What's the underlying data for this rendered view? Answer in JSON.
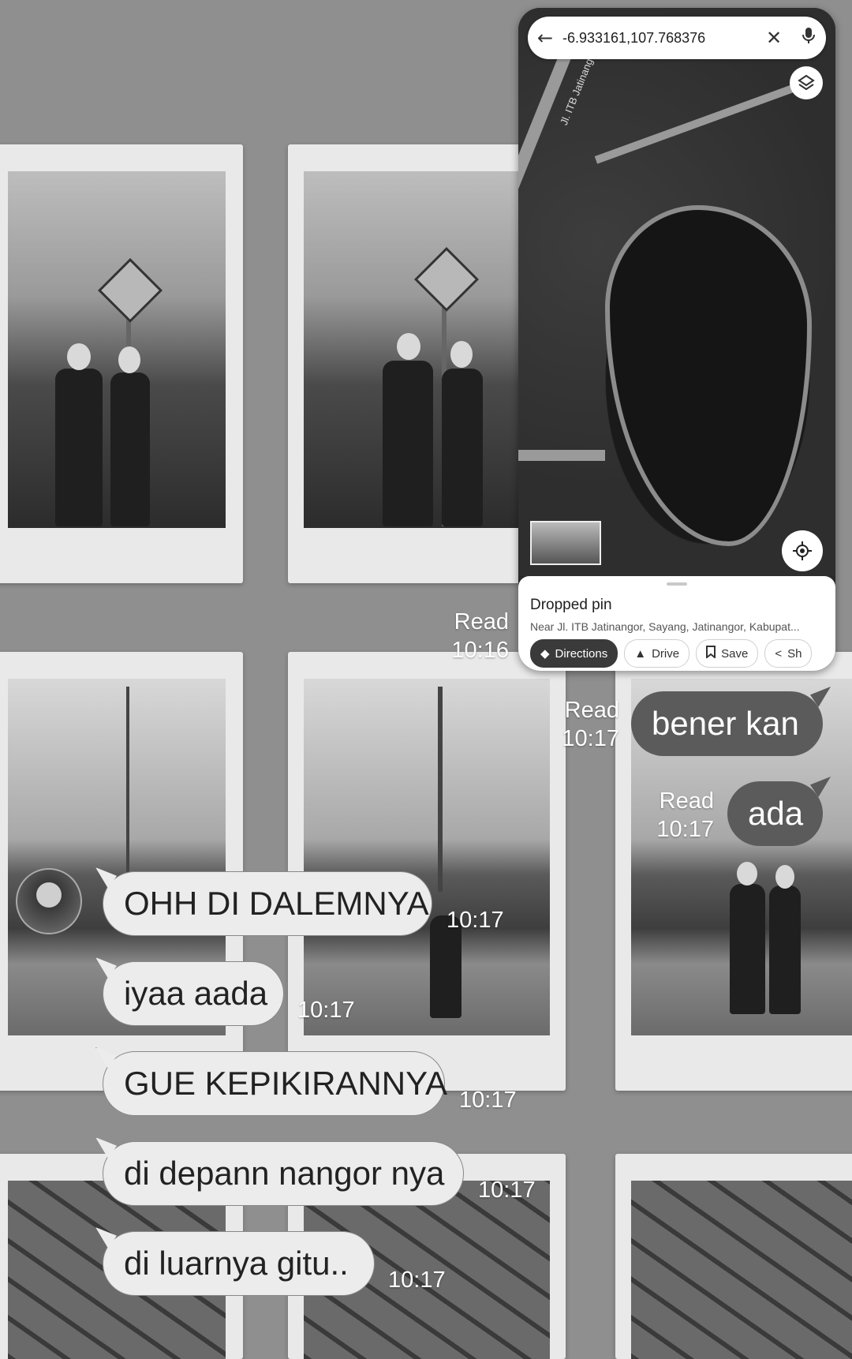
{
  "maps": {
    "search_query": "-6.933161,107.768376",
    "street_label": "Jl. ITB Jatinangor",
    "place_title": "Dropped pin",
    "place_subtitle": "Near Jl. ITB Jatinangor, Sayang, Jatinangor, Kabupat...",
    "actions": [
      {
        "label": "Directions",
        "icon": "directions-icon"
      },
      {
        "label": "Drive",
        "icon": "navigation-arrow-icon"
      },
      {
        "label": "Save",
        "icon": "bookmark-icon"
      },
      {
        "label": "Sh",
        "icon": "share-icon"
      }
    ]
  },
  "chat": {
    "status_read": "Read",
    "outgoing": [
      {
        "text": "",
        "read": "Read",
        "time": "10:16"
      },
      {
        "text": "bener kan",
        "read": "Read",
        "time": "10:17"
      },
      {
        "text": "ada",
        "read": "Read",
        "time": "10:17"
      }
    ],
    "incoming": [
      {
        "text": "OHH DI DALEMNYA",
        "time": "10:17"
      },
      {
        "text": "iyaa aada",
        "time": "10:17"
      },
      {
        "text": "GUE KEPIKIRANNYA",
        "time": "10:17"
      },
      {
        "text": "di depann nangor nya",
        "time": "10:17"
      },
      {
        "text": "di luarnya gitu..",
        "time": "10:17"
      }
    ]
  }
}
